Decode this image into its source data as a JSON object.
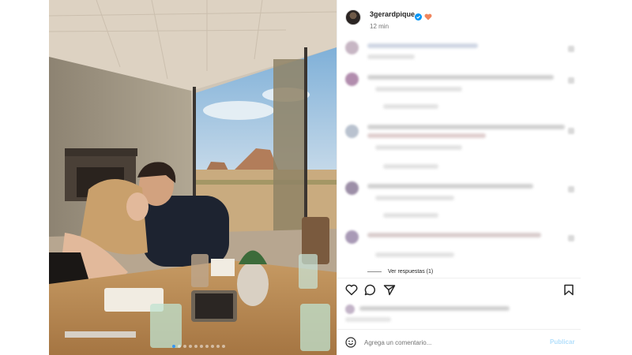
{
  "post": {
    "username": "3gerardpique",
    "verified": true,
    "emoji": "orange-heart",
    "time_ago": "12 min",
    "carousel": {
      "total_images": 10,
      "current_index": 1
    }
  },
  "comments": {
    "view_replies_label": "Ver respuestas (1)"
  },
  "actions": {
    "like_icon": "heart-outline-icon",
    "comment_icon": "comment-bubble-icon",
    "share_icon": "paper-plane-icon",
    "save_icon": "bookmark-icon"
  },
  "comment_box": {
    "placeholder": "Agrega un comentario...",
    "post_label": "Publicar"
  },
  "colors": {
    "verified_blue": "#0095f6",
    "heart_orange": "#f0855d",
    "post_disabled": "#b2dffc"
  }
}
